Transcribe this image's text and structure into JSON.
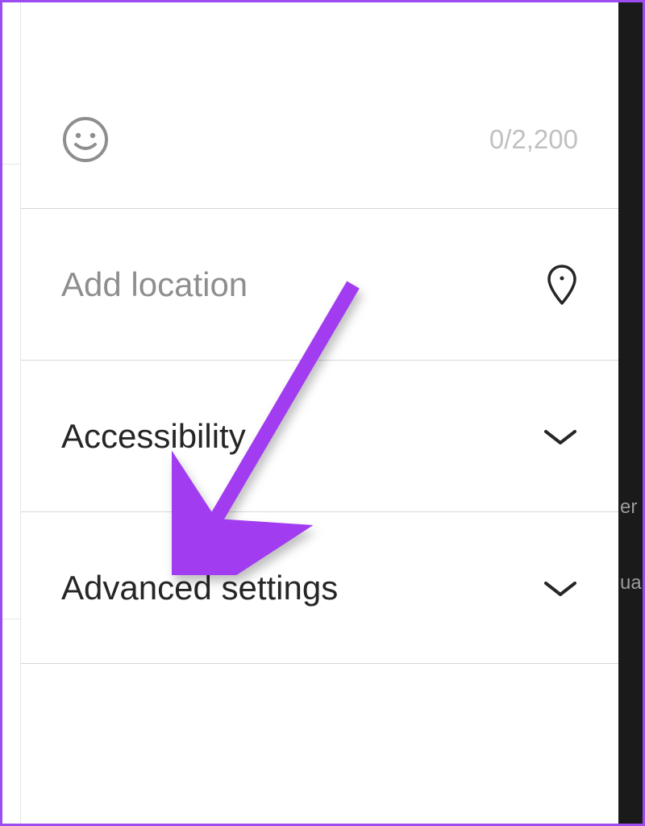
{
  "caption": {
    "char_counter": "0/2,200"
  },
  "location": {
    "placeholder": "Add location"
  },
  "sections": {
    "accessibility": {
      "label": "Accessibility"
    },
    "advanced": {
      "label": "Advanced settings"
    }
  },
  "annotation_color": "#a23cf0"
}
